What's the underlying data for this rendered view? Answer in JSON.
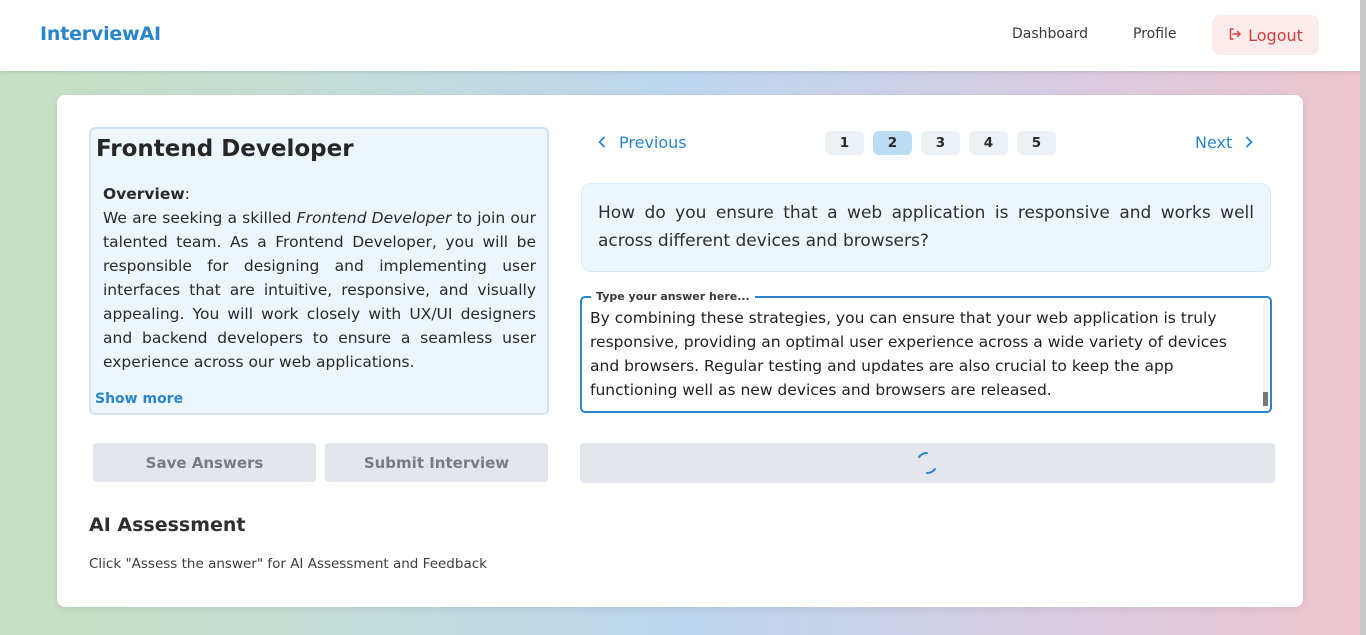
{
  "header": {
    "brand": "InterviewAI",
    "nav": {
      "dashboard": "Dashboard",
      "profile": "Profile",
      "logout": "Logout"
    }
  },
  "job": {
    "title": "Frontend Developer",
    "overview_label": "Overview",
    "overview_colon": ":",
    "overview_pre": "We are seeking a skilled ",
    "overview_em": "Frontend Developer",
    "overview_post": " to join our talented team. As a Frontend Developer, you will be responsible for designing and implementing user interfaces that are intuitive, responsive, and visually appealing. You will work closely with UX/UI designers and backend developers to ensure a seamless user experience across our web applications.",
    "show_more": "Show more"
  },
  "actions": {
    "save": "Save Answers",
    "submit": "Submit Interview"
  },
  "assessment": {
    "title": "AI Assessment",
    "hint": "Click \"Assess the answer\" for AI Assessment and Feedback"
  },
  "pager": {
    "previous": "Previous",
    "next": "Next",
    "pages": [
      "1",
      "2",
      "3",
      "4",
      "5"
    ],
    "active_page": "2"
  },
  "question": {
    "text": "How do you ensure that a web application is responsive and works well across different devices and browsers?"
  },
  "answer": {
    "label": "Type your answer here...",
    "value": "By combining these strategies, you can ensure that your web application is truly responsive, providing an optimal user experience across a wide variety of devices and browsers. Regular testing and updates are also crucial to keep the app functioning well as new devices and browsers are released."
  },
  "colors": {
    "accent": "#2b86c9",
    "logout": "#d83d3d",
    "panel_bg": "#eef6fd",
    "button_gray": "#e3e6ea"
  },
  "icons": {
    "logout": "logout-icon",
    "previous": "chevron-left-icon",
    "next": "chevron-right-icon",
    "loading": "spinner-icon"
  }
}
